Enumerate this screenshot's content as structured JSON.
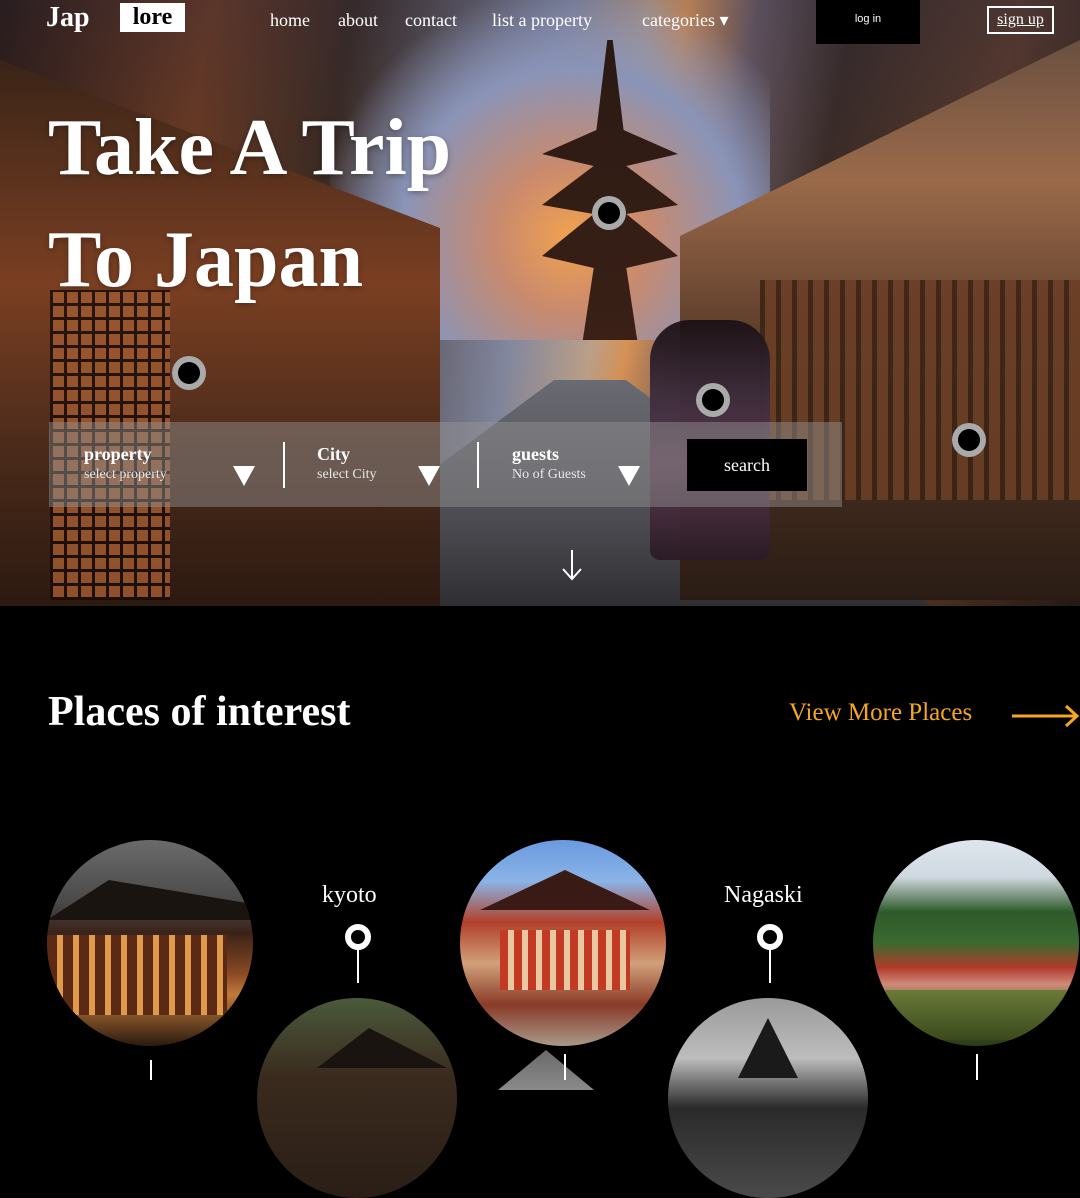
{
  "nav": {
    "logo_left": "Jap",
    "logo_right": "lore",
    "links": [
      "home",
      "about",
      "contact",
      "list a property",
      "categories ▾"
    ],
    "login": "log in",
    "signup": "sign up"
  },
  "hero": {
    "title_line1": "Take A Trip",
    "title_line2": "To Japan"
  },
  "search": {
    "property_label": "property",
    "property_sub": "select property",
    "city_label": "City",
    "city_sub": "select City",
    "guests_label": "guests",
    "guests_sub": "No of Guests",
    "button": "search"
  },
  "places": {
    "title": "Places of interest",
    "view_more": "View More Places",
    "cities": [
      "kyoto",
      "Nagaski"
    ]
  },
  "colors": {
    "accent": "#f5a623",
    "background": "#000000"
  }
}
